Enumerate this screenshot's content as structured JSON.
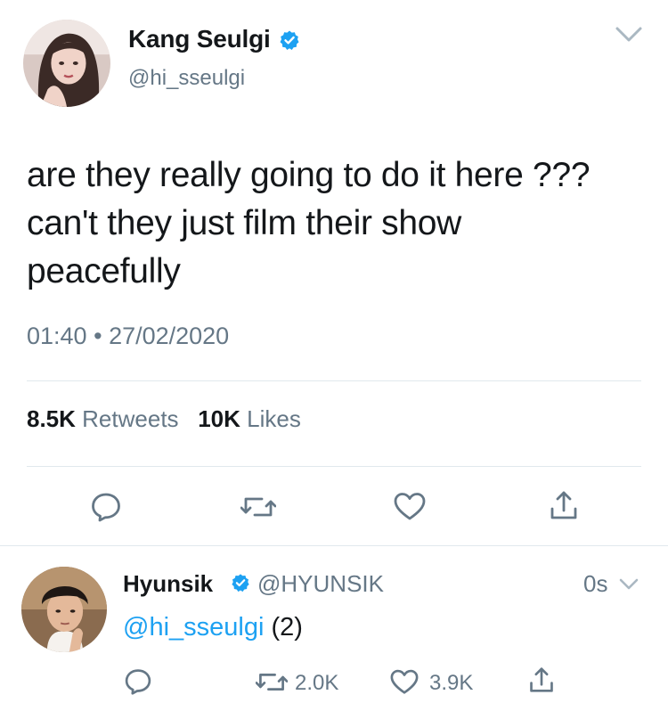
{
  "tweet": {
    "author_name": "Kang Seulgi",
    "author_handle": "@hi_sseulgi",
    "text": "are they really going to do it here ???\ncan't they just film their show\npeacefully",
    "time": "01:40",
    "separator": "•",
    "date": "27/02/2020",
    "retweets_count": "8.5K",
    "retweets_label": "Retweets",
    "likes_count": "10K",
    "likes_label": "Likes",
    "actions": [
      "reply-icon",
      "retweet-icon",
      "like-icon",
      "share-icon"
    ]
  },
  "reply": {
    "author_name": "Hyunsik",
    "author_handle": "@HYUNSIK",
    "time": "0s",
    "mention": "@hi_sseulgi",
    "text": "(2)",
    "retweets_count": "2.0K",
    "likes_count": "3.9K",
    "actions": [
      "reply-icon",
      "retweet-icon",
      "like-icon",
      "share-icon"
    ]
  },
  "colors": {
    "link_blue": "#1da1f2",
    "secondary_gray": "#657786",
    "text_black": "#14171a",
    "divider": "#e1e8ed"
  }
}
